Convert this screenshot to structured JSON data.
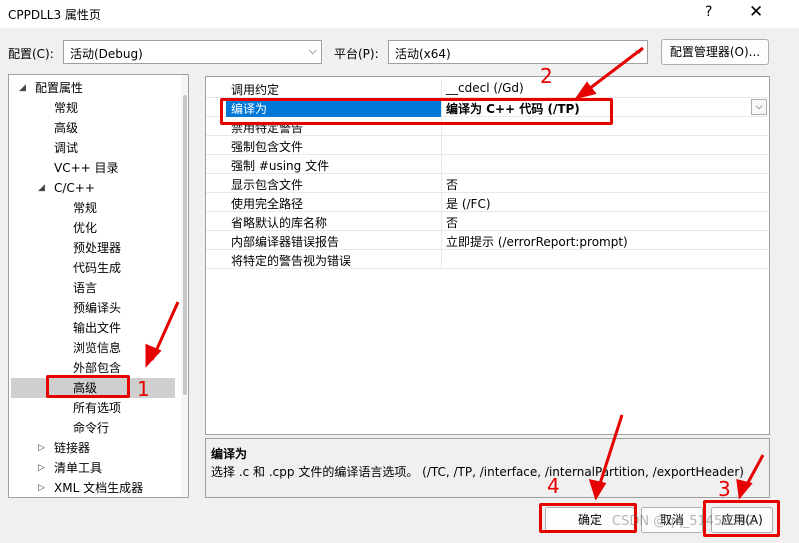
{
  "window": {
    "title": "CPPDLL3 属性页",
    "help": "?",
    "close": "✕"
  },
  "toolbar": {
    "config_label": "配置(C):",
    "config_value": "活动(Debug)",
    "platform_label": "平台(P):",
    "platform_value": "活动(x64)",
    "config_manager": "配置管理器(O)..."
  },
  "tree": {
    "items": [
      {
        "label": "配置属性",
        "expander": "◢"
      },
      {
        "label": "常规"
      },
      {
        "label": "高级"
      },
      {
        "label": "调试"
      },
      {
        "label": "VC++ 目录"
      },
      {
        "label": "C/C++",
        "expander": "◢"
      },
      {
        "label": "常规"
      },
      {
        "label": "优化"
      },
      {
        "label": "预处理器"
      },
      {
        "label": "代码生成"
      },
      {
        "label": "语言"
      },
      {
        "label": "预编译头"
      },
      {
        "label": "输出文件"
      },
      {
        "label": "浏览信息"
      },
      {
        "label": "外部包含"
      },
      {
        "label": "高级",
        "selected": true
      },
      {
        "label": "所有选项"
      },
      {
        "label": "命令行"
      },
      {
        "label": "链接器",
        "expander": "▷"
      },
      {
        "label": "清单工具",
        "expander": "▷"
      },
      {
        "label": "XML 文档生成器",
        "expander": "▷"
      }
    ]
  },
  "grid": {
    "rows": [
      {
        "name": "调用约定",
        "value": "__cdecl (/Gd)"
      },
      {
        "name": "编译为",
        "value": "编译为 C++ 代码 (/TP)",
        "selected": true
      },
      {
        "name": "禁用特定警告",
        "value": ""
      },
      {
        "name": "强制包含文件",
        "value": ""
      },
      {
        "name": "强制 #using 文件",
        "value": ""
      },
      {
        "name": "显示包含文件",
        "value": "否"
      },
      {
        "name": "使用完全路径",
        "value": "是 (/FC)"
      },
      {
        "name": "省略默认的库名称",
        "value": "否"
      },
      {
        "name": "内部编译器错误报告",
        "value": "立即提示 (/errorReport:prompt)"
      },
      {
        "name": "将特定的警告视为错误",
        "value": ""
      }
    ],
    "dropdown_icon": "chevron-down-icon"
  },
  "description": {
    "title": "编译为",
    "text": "选择 .c 和 .cpp 文件的编译语言选项。    (/TC, /TP, /interface, /internalPartition, /exportHeader)"
  },
  "buttons": {
    "ok": "确定",
    "cancel": "取消",
    "apply": "应用(A)"
  },
  "annotations": {
    "n1": "1",
    "n2": "2",
    "n3": "3",
    "n4": "4",
    "color": "#e60000"
  },
  "watermark": "CSDN @qq_51450342"
}
